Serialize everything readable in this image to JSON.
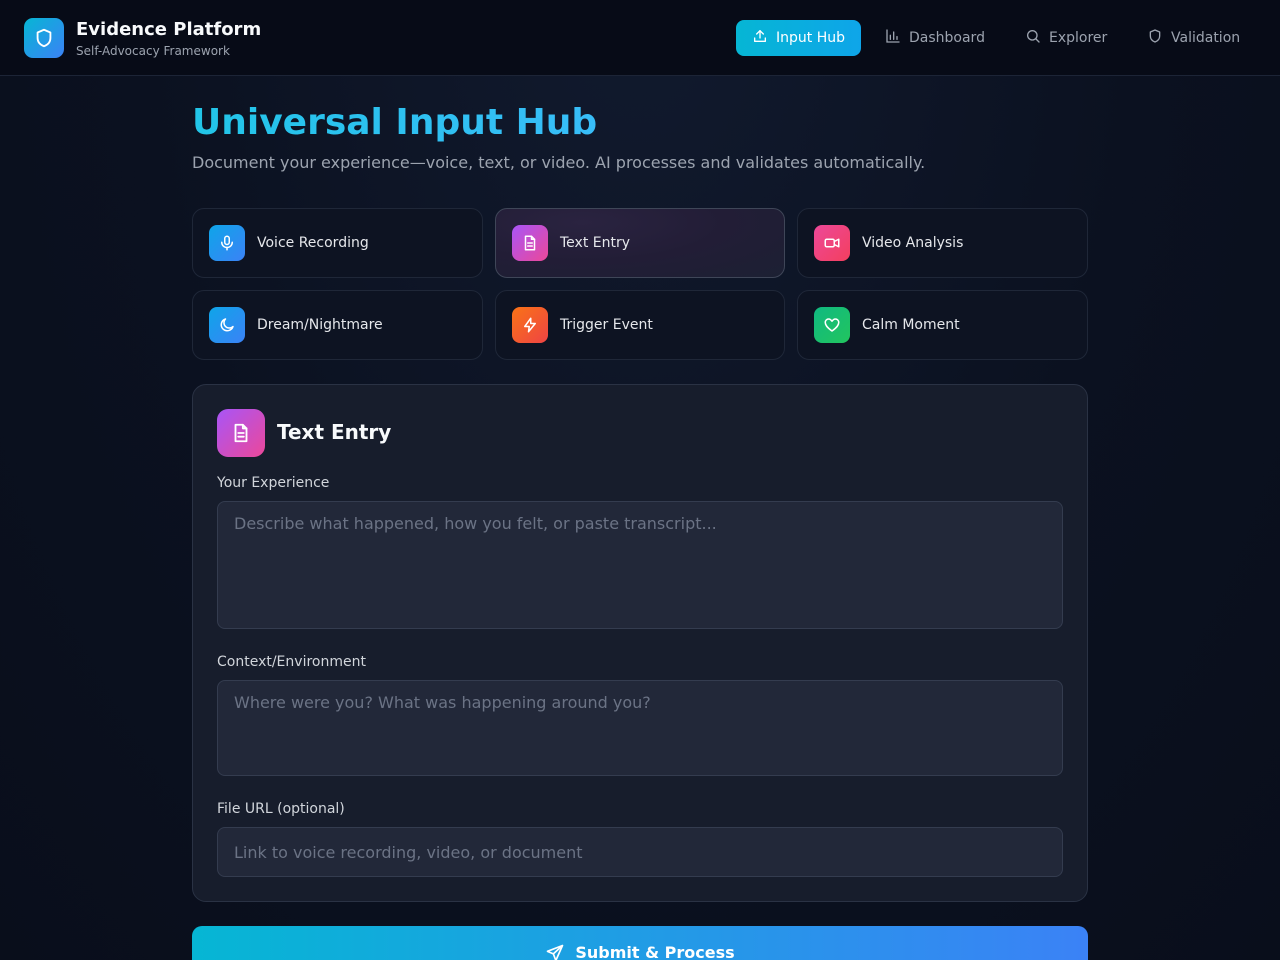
{
  "header": {
    "title": "Evidence Platform",
    "subtitle": "Self-Advocacy Framework",
    "logo_icon": "shield-icon",
    "nav": [
      {
        "label": "Input Hub",
        "icon": "upload-icon",
        "active": true
      },
      {
        "label": "Dashboard",
        "icon": "bar-chart-icon",
        "active": false
      },
      {
        "label": "Explorer",
        "icon": "search-icon",
        "active": false
      },
      {
        "label": "Validation",
        "icon": "shield-icon",
        "active": false
      }
    ]
  },
  "page": {
    "title": "Universal Input Hub",
    "description": "Document your experience—voice, text, or video. AI processes and validates automatically."
  },
  "input_types": [
    {
      "label": "Voice Recording",
      "icon": "microphone-icon",
      "color": "#3b82f6",
      "selected": false
    },
    {
      "label": "Text Entry",
      "icon": "document-icon",
      "color": "#d946ef",
      "selected": true
    },
    {
      "label": "Video Analysis",
      "icon": "video-icon",
      "color": "#f43f5e",
      "selected": false
    },
    {
      "label": "Dream/Nightmare",
      "icon": "moon-icon",
      "color": "#3b82f6",
      "selected": false
    },
    {
      "label": "Trigger Event",
      "icon": "lightning-icon",
      "color": "#f97316",
      "selected": false
    },
    {
      "label": "Calm Moment",
      "icon": "heart-icon",
      "color": "#22c55e",
      "selected": false
    }
  ],
  "form": {
    "title": "Text Entry",
    "experience": {
      "label": "Your Experience",
      "placeholder": "Describe what happened, how you felt, or paste transcript...",
      "value": ""
    },
    "context": {
      "label": "Context/Environment",
      "placeholder": "Where were you? What was happening around you?",
      "value": ""
    },
    "file_url": {
      "label": "File URL (optional)",
      "placeholder": "Link to voice recording, video, or document",
      "value": ""
    },
    "submit_label": "Submit & Process"
  }
}
